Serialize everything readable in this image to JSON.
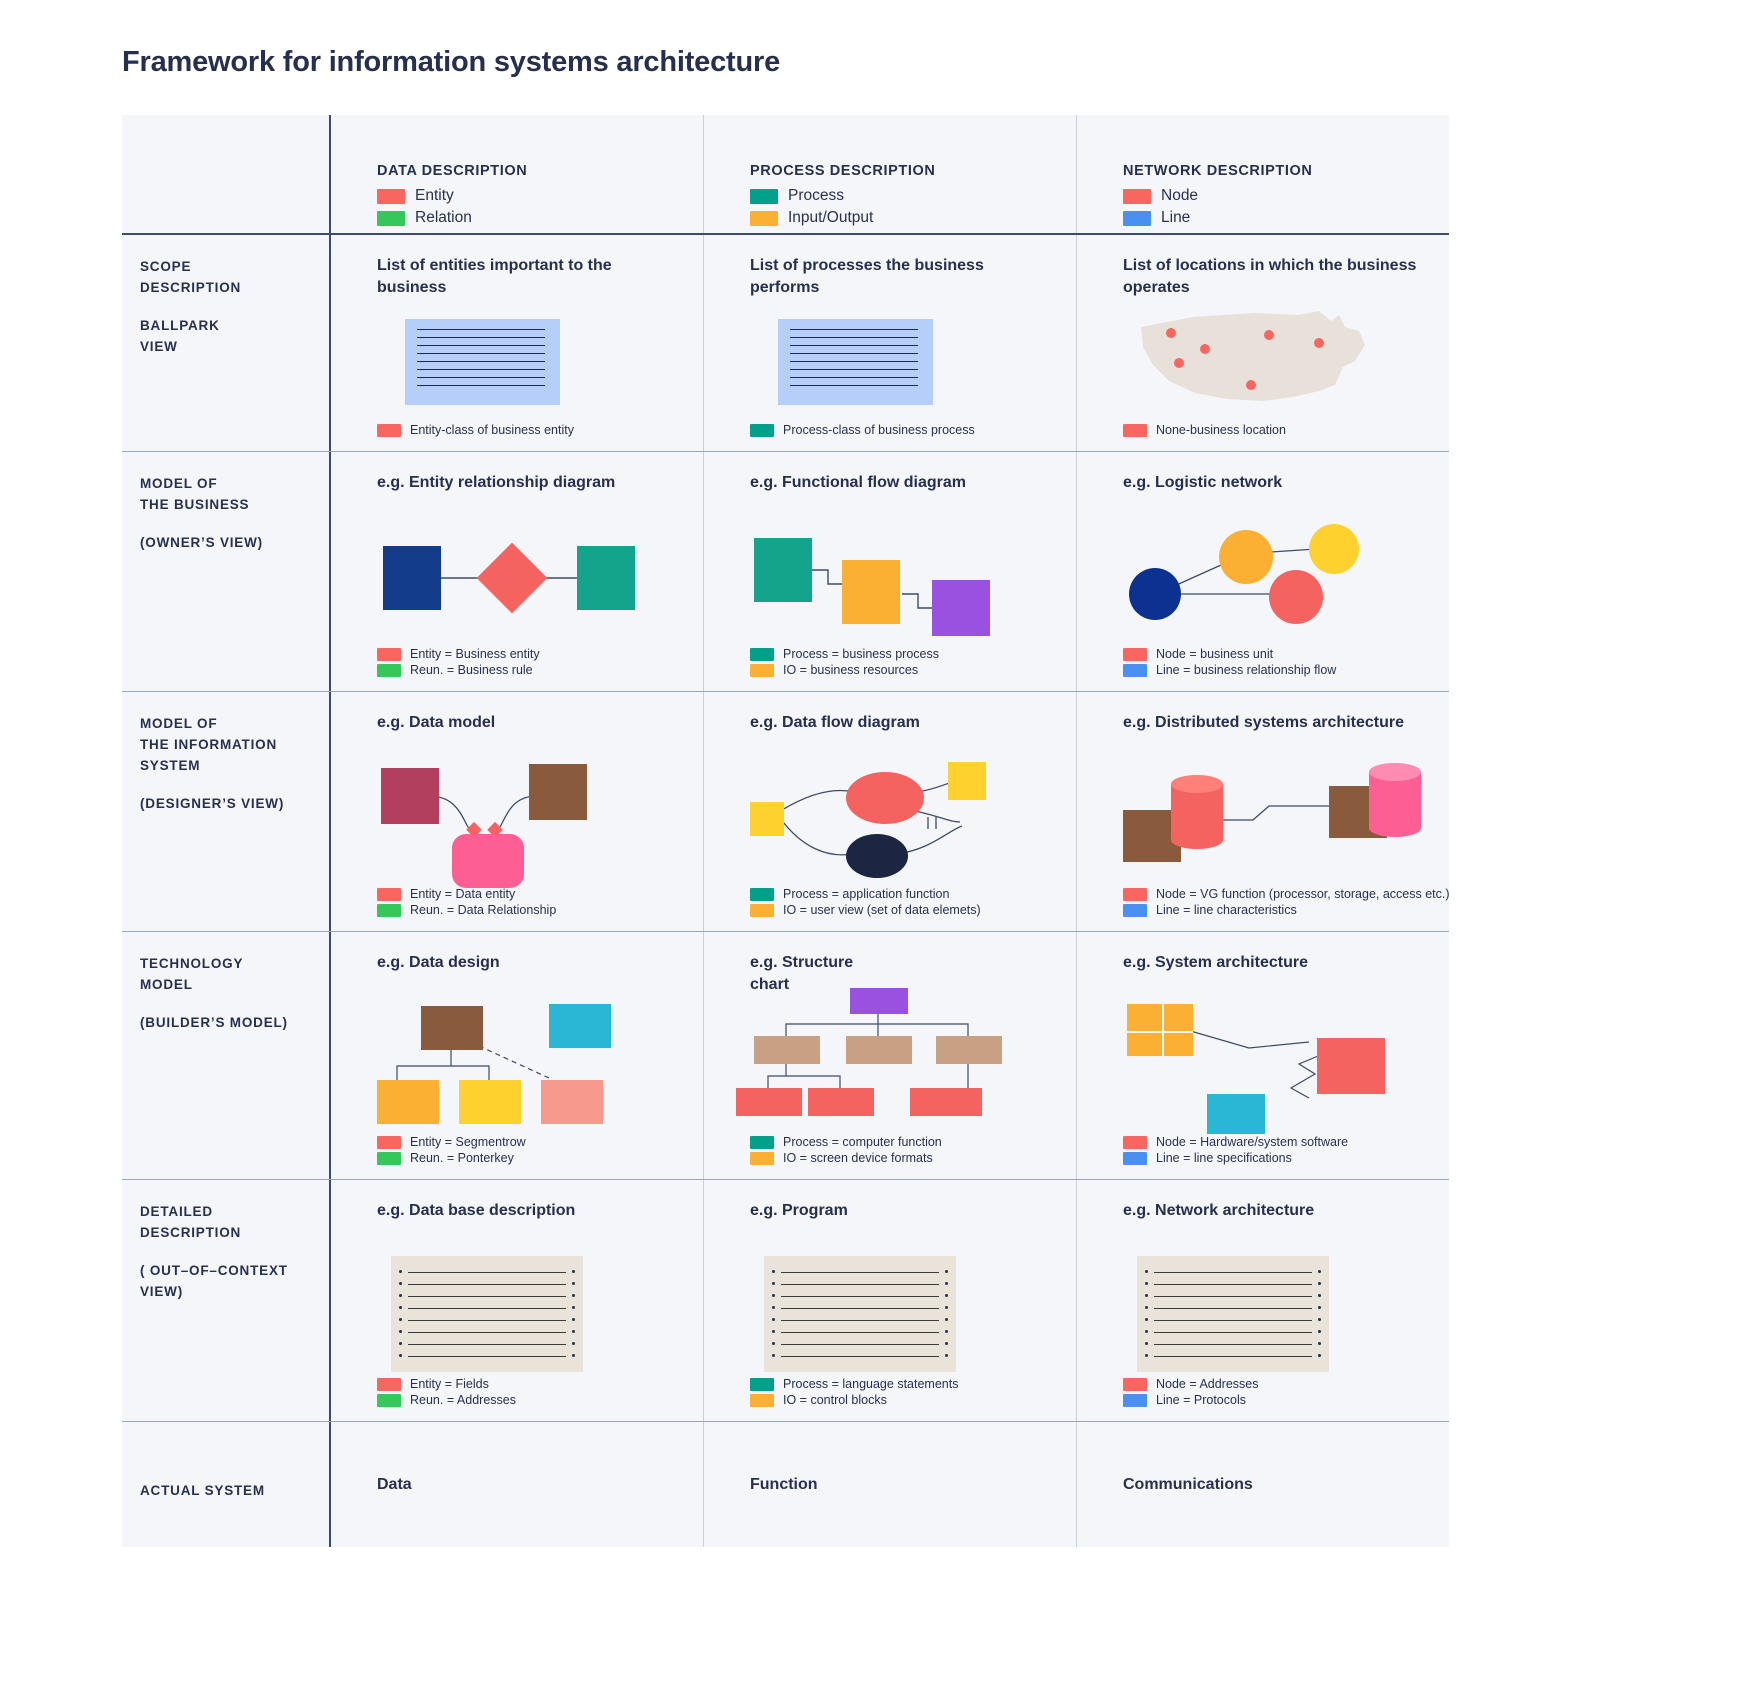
{
  "title": "Framework for information systems architecture",
  "colors": {
    "entity_red": "#f9655f",
    "relation_green": "#35c759",
    "process_teal": "#00a08a",
    "io_orange": "#fbb034",
    "node_red": "#f9655f",
    "line_blue": "#4a90f0",
    "ink": "#26304e",
    "panel_bg": "#f4f6fa"
  },
  "columns": [
    {
      "heading": "DATA DESCRIPTION",
      "legend": [
        {
          "label": "Entity",
          "color": "#f9655f"
        },
        {
          "label": "Relation",
          "color": "#35c759"
        }
      ]
    },
    {
      "heading": "PROCESS DESCRIPTION",
      "legend": [
        {
          "label": "Process",
          "color": "#00a08a"
        },
        {
          "label": "Input/Output",
          "color": "#fbb034"
        }
      ]
    },
    {
      "heading": "NETWORK DESCRIPTION",
      "legend": [
        {
          "label": "Node",
          "color": "#f9655f"
        },
        {
          "label": "Line",
          "color": "#4a90f0"
        }
      ]
    }
  ],
  "rows": [
    {
      "label_main": "SCOPE\nDESCRIPTION",
      "label_sub": "BALLPARK\nVIEW",
      "cells": [
        {
          "heading": "List of entities important to the business",
          "legend": [
            {
              "label": "Entity-class of business entity",
              "color": "#f9655f"
            }
          ]
        },
        {
          "heading": "List of processes the business performs",
          "legend": [
            {
              "label": "Process-class of business process",
              "color": "#00a08a"
            }
          ]
        },
        {
          "heading": "List of locations in which the business operates",
          "legend": [
            {
              "label": "None-business location",
              "color": "#f9655f"
            }
          ]
        }
      ]
    },
    {
      "label_main": "MODEL OF\nTHE BUSINESS",
      "label_sub": "(OWNER’S VIEW)",
      "cells": [
        {
          "heading": "e.g. Entity relationship diagram",
          "legend": [
            {
              "label": "Entity = Business entity",
              "color": "#f9655f"
            },
            {
              "label": "Reun. = Business rule",
              "color": "#35c759"
            }
          ]
        },
        {
          "heading": "e.g. Functional flow diagram",
          "legend": [
            {
              "label": "Process = business process",
              "color": "#00a08a"
            },
            {
              "label": "IO = business resources",
              "color": "#fbb034"
            }
          ]
        },
        {
          "heading": "e.g. Logistic network",
          "legend": [
            {
              "label": "Node = business unit",
              "color": "#f9655f"
            },
            {
              "label": "Line = business relationship flow",
              "color": "#4a90f0"
            }
          ]
        }
      ]
    },
    {
      "label_main": "MODEL OF\nTHE INFORMATION\nSYSTEM",
      "label_sub": "(DESIGNER’S VIEW)",
      "cells": [
        {
          "heading": "e.g. Data model",
          "legend": [
            {
              "label": "Entity = Data entity",
              "color": "#f9655f"
            },
            {
              "label": "Reun. = Data Relationship",
              "color": "#35c759"
            }
          ]
        },
        {
          "heading": "e.g. Data flow diagram",
          "legend": [
            {
              "label": "Process = application function",
              "color": "#00a08a"
            },
            {
              "label": "IO = user view (set of data elemets)",
              "color": "#fbb034"
            }
          ]
        },
        {
          "heading": "e.g. Distributed systems architecture",
          "legend": [
            {
              "label": "Node = VG function (processor, storage, access etc.)",
              "color": "#f9655f"
            },
            {
              "label": "Line = line characteristics",
              "color": "#4a90f0"
            }
          ]
        }
      ]
    },
    {
      "label_main": "TECHNOLOGY\nMODEL",
      "label_sub": "(BUILDER’S MODEL)",
      "cells": [
        {
          "heading": "e.g. Data design",
          "legend": [
            {
              "label": "Entity = Segmentrow",
              "color": "#f9655f"
            },
            {
              "label": "Reun. = Ponterkey",
              "color": "#35c759"
            }
          ]
        },
        {
          "heading": "e.g. Structure\nchart",
          "legend": [
            {
              "label": "Process = computer function",
              "color": "#00a08a"
            },
            {
              "label": "IO = screen device formats",
              "color": "#fbb034"
            }
          ]
        },
        {
          "heading": "e.g. System architecture",
          "legend": [
            {
              "label": "Node = Hardware/system software",
              "color": "#f9655f"
            },
            {
              "label": "Line = line specifications",
              "color": "#4a90f0"
            }
          ]
        }
      ]
    },
    {
      "label_main": "DETAILED\nDESCRIPTION",
      "label_sub": "( OUT–OF–CONTEXT\nVIEW)",
      "cells": [
        {
          "heading": "e.g. Data base description",
          "legend": [
            {
              "label": "Entity = Fields",
              "color": "#f9655f"
            },
            {
              "label": "Reun. = Addresses",
              "color": "#35c759"
            }
          ]
        },
        {
          "heading": "e.g. Program",
          "legend": [
            {
              "label": "Process = language statements",
              "color": "#00a08a"
            },
            {
              "label": "IO = control blocks",
              "color": "#fbb034"
            }
          ]
        },
        {
          "heading": "e.g. Network architecture",
          "legend": [
            {
              "label": "Node = Addresses",
              "color": "#f9655f"
            },
            {
              "label": "Line = Protocols",
              "color": "#4a90f0"
            }
          ]
        }
      ]
    }
  ],
  "footer": {
    "label": "ACTUAL SYSTEM",
    "values": [
      "Data",
      "Function",
      "Communications"
    ]
  }
}
